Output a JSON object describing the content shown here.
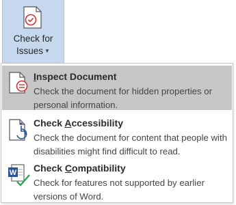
{
  "ribbon": {
    "check_button": {
      "label_line1": "Check for",
      "label_line2": "Issues",
      "icon": "document-check-icon"
    }
  },
  "menu": {
    "items": [
      {
        "title_pre": "",
        "title_accel": "I",
        "title_post": "nspect Document",
        "description": "Check the document for hidden properties or personal information.",
        "icon": "inspect-document-icon",
        "highlighted": true
      },
      {
        "title_pre": "Check ",
        "title_accel": "A",
        "title_post": "ccessibility",
        "description": "Check the document for content that people with disabilities might find difficult to read.",
        "icon": "accessibility-check-icon",
        "highlighted": false
      },
      {
        "title_pre": "Check ",
        "title_accel": "C",
        "title_post": "ompatibility",
        "description": "Check for features not supported by earlier versions of Word.",
        "icon": "word-compatibility-icon",
        "highlighted": false
      }
    ]
  },
  "colors": {
    "button_bg": "#c5d8ee",
    "hover_bg": "#c6c6c6",
    "accent_red": "#d03030",
    "word_blue": "#2b579a",
    "check_green": "#22a04a"
  }
}
